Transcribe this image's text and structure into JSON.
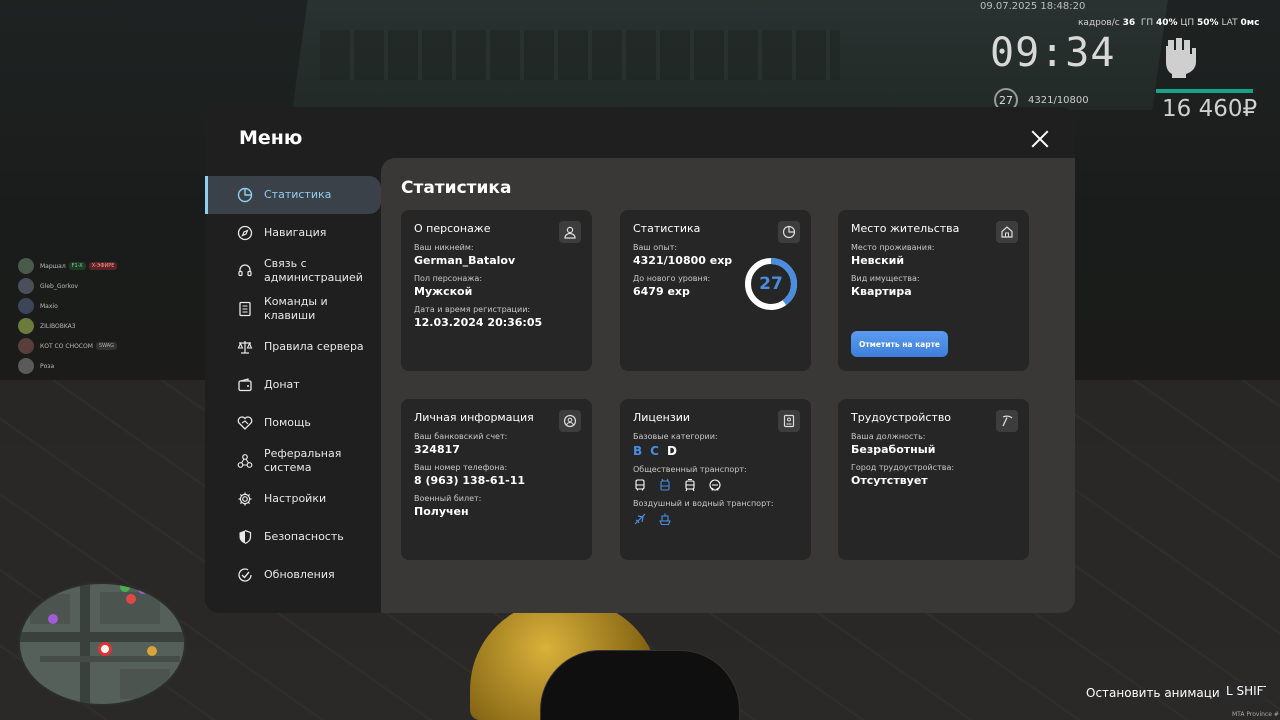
{
  "hud": {
    "datetime": "09.07.2025 18:48:20",
    "fps_label": "кадров/с",
    "fps_value": "36",
    "gpu_label": "ГП",
    "gpu_value": "40%",
    "cpu_label": "ЦП",
    "cpu_value": "50%",
    "lat_label": "LAT",
    "lat_value": "0мс",
    "clock": "09:34",
    "level": "27",
    "exp": "4321/10800",
    "money": "16 460₽"
  },
  "players": [
    {
      "name": "Маршал",
      "tag1": "F1-X",
      "tag2": "X-ЭФИРЕ"
    },
    {
      "name": "Gleb_Gorkov"
    },
    {
      "name": "Maxio"
    },
    {
      "name": "ZILIBOBKA3"
    },
    {
      "name": "КОТ СО СНОСОМ",
      "tag1": "SWAG"
    },
    {
      "name": "Роза"
    }
  ],
  "bottom": {
    "stop_animation": "Остановить анимацию",
    "key": "L SHIFT",
    "mta": "MTA Province #"
  },
  "menu": {
    "title": "Меню",
    "sidebar": [
      {
        "label": "Статистика",
        "icon": "pie-chart-icon",
        "active": true
      },
      {
        "label": "Навигация",
        "icon": "compass-icon"
      },
      {
        "label": "Связь с администрацией",
        "icon": "headset-icon"
      },
      {
        "label": "Команды и клавиши",
        "icon": "document-icon"
      },
      {
        "label": "Правила сервера",
        "icon": "scales-icon"
      },
      {
        "label": "Донат",
        "icon": "wallet-icon"
      },
      {
        "label": "Помощь",
        "icon": "handshake-icon"
      },
      {
        "label": "Реферальная система",
        "icon": "network-icon"
      },
      {
        "label": "Настройки",
        "icon": "gear-icon"
      },
      {
        "label": "Безопасность",
        "icon": "shield-icon"
      },
      {
        "label": "Обновления",
        "icon": "check-circle-icon"
      }
    ],
    "content_title": "Статистика",
    "cards": {
      "character": {
        "title": "О персонаже",
        "nick_label": "Ваш никнейм:",
        "nick": "German_Batalov",
        "gender_label": "Пол персонажа:",
        "gender": "Мужской",
        "reg_label": "Дата и время регистрации:",
        "reg": "12.03.2024 20:36:05"
      },
      "stats": {
        "title": "Статистика",
        "exp_label": "Ваш опыт:",
        "exp": "4321/10800 exp",
        "next_label": "До нового уровня:",
        "next": "6479 exp",
        "level": "27",
        "progress": 0.4
      },
      "residence": {
        "title": "Место жительства",
        "place_label": "Место проживания:",
        "place": "Невский",
        "property_label": "Вид имущества:",
        "property": "Квартира",
        "button": "Отметить на карте"
      },
      "personal": {
        "title": "Личная информация",
        "bank_label": "Ваш банковский счет:",
        "bank": "324817",
        "phone_label": "Ваш номер телефона:",
        "phone": "8 (963) 138-61-11",
        "military_label": "Военный билет:",
        "military": "Получен"
      },
      "licenses": {
        "title": "Лицензии",
        "basic_label": "Базовые категории:",
        "categories": [
          {
            "letter": "B",
            "active": true
          },
          {
            "letter": "C",
            "active": true
          },
          {
            "letter": "D",
            "active": false
          }
        ],
        "public_label": "Общественный транспорт:",
        "air_label": "Воздушный и водный транспорт:"
      },
      "employment": {
        "title": "Трудоустройство",
        "position_label": "Ваша должность:",
        "position": "Безработный",
        "city_label": "Город трудоустройства:",
        "city": "Отсутствует"
      }
    }
  },
  "colors": {
    "accent": "#4a8de0",
    "active_sidebar": "#8fd0ee",
    "hud_bar": "#16a389"
  }
}
